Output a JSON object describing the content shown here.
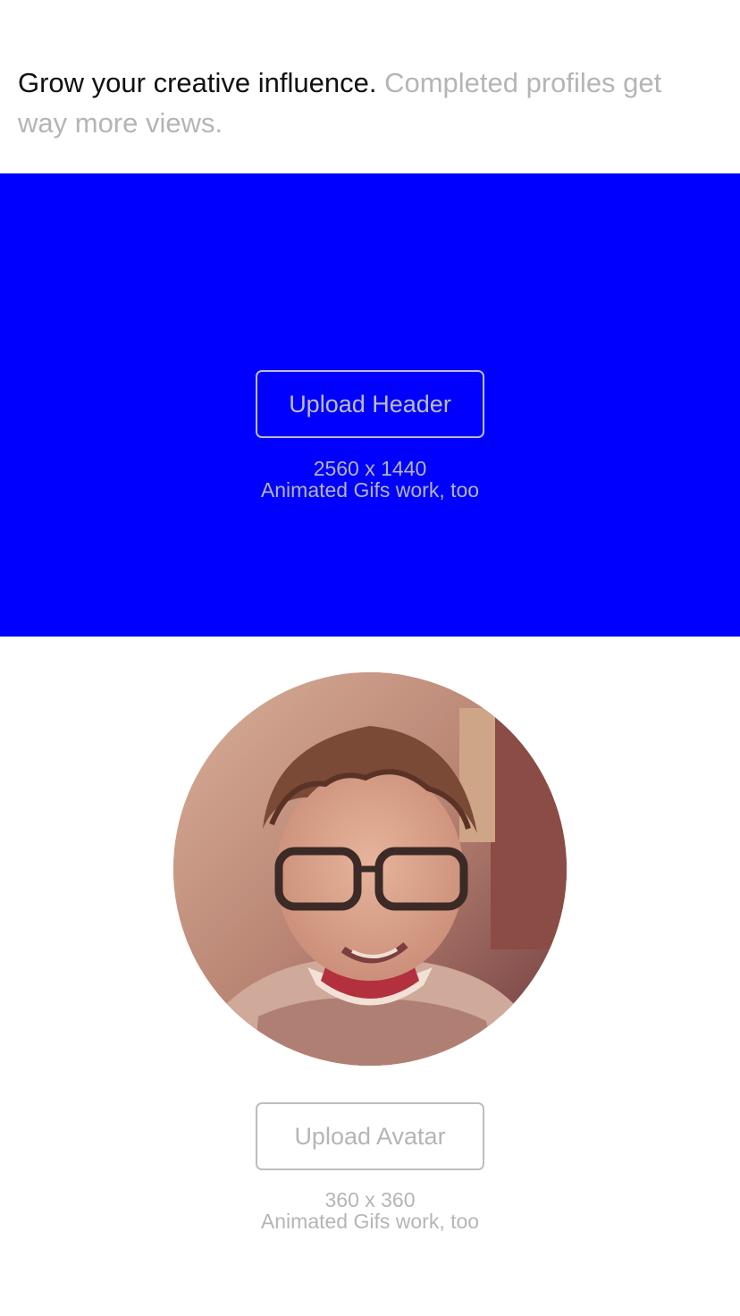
{
  "intro": {
    "lead": "Grow your creative influence.",
    "rest": "Completed profiles get way more views."
  },
  "header_upload": {
    "button_label": "Upload Header",
    "dimensions": "2560 x 1440",
    "note": "Animated Gifs work, too",
    "background_color": "#0000ff"
  },
  "avatar_upload": {
    "button_label": "Upload Avatar",
    "dimensions": "360 x 360",
    "note": "Animated Gifs work, too"
  }
}
